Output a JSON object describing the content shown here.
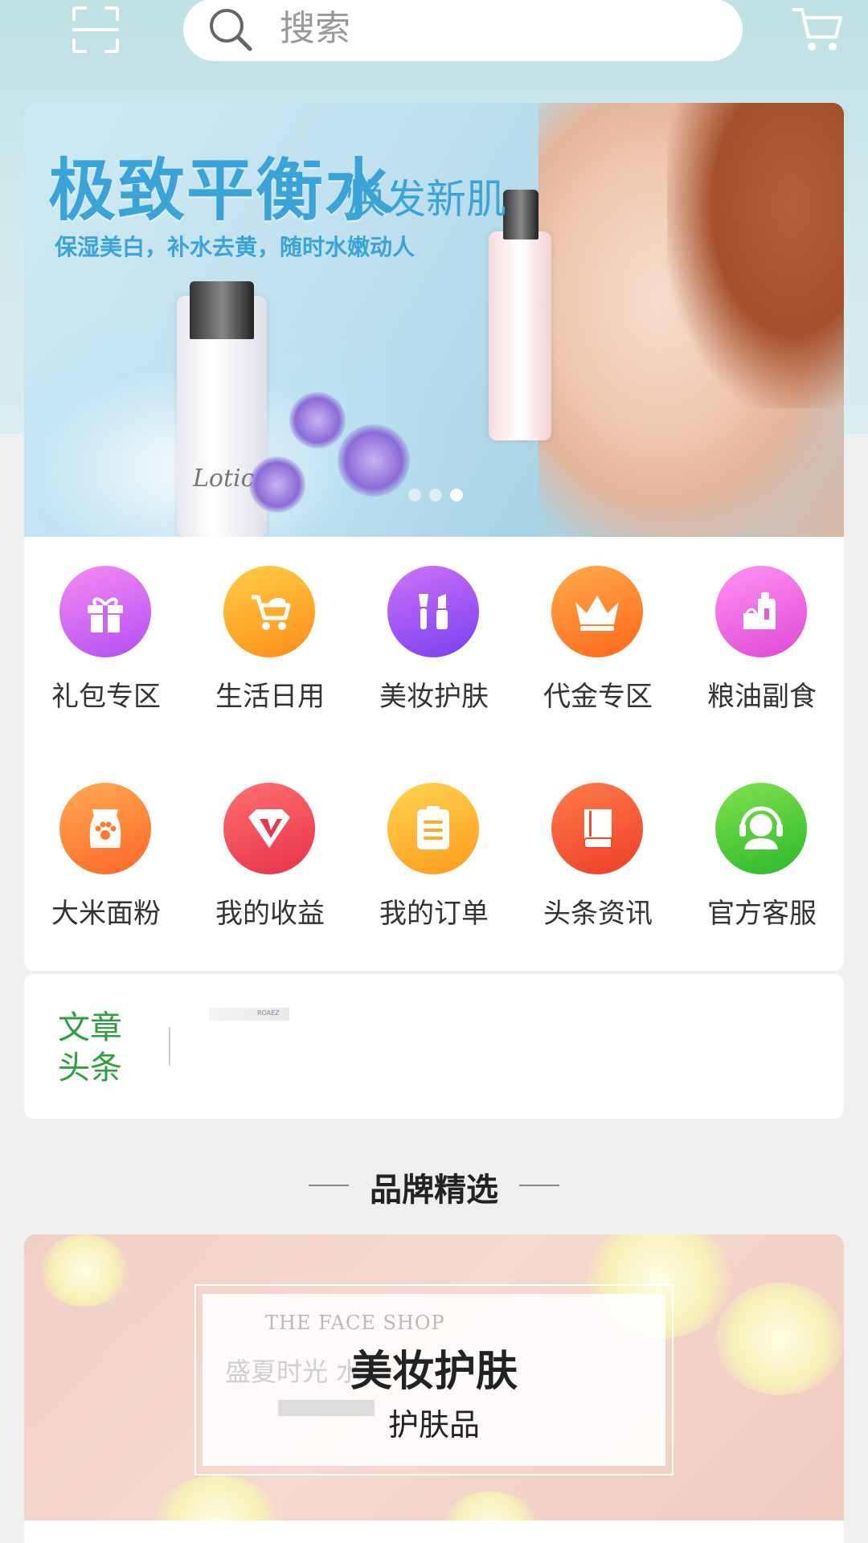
{
  "header": {
    "search_placeholder": "搜索",
    "scan_icon": "scan-icon",
    "cart_icon": "cart-icon"
  },
  "banner": {
    "title": "极致平衡水",
    "title_small": "焕发新肌",
    "subtitle": "保湿美白，补水去黄，随时水嫩动人",
    "bottle_text": "Lotic",
    "dots": 3,
    "active_dot": 2
  },
  "categories": {
    "items": [
      {
        "label": "礼包专区",
        "icon": "gift-icon",
        "color1": "#f07ff0",
        "color2": "#b44ef0"
      },
      {
        "label": "生活日用",
        "icon": "stroller-icon",
        "color1": "#ffc83d",
        "color2": "#ff8f1a"
      },
      {
        "label": "美妆护肤",
        "icon": "makeup-icon",
        "color1": "#c56cf8",
        "color2": "#7b3ff0"
      },
      {
        "label": "代金专区",
        "icon": "crown-icon",
        "color1": "#ffa347",
        "color2": "#ff6a1a"
      },
      {
        "label": "粮油副食",
        "icon": "oil-icon",
        "color1": "#ff8cf0",
        "color2": "#e04ed8"
      },
      {
        "label": "大米面粉",
        "icon": "rice-bag-icon",
        "color1": "#ffa350",
        "color2": "#ff6a28"
      },
      {
        "label": "我的收益",
        "icon": "diamond-icon",
        "color1": "#ff6b6b",
        "color2": "#e8344a"
      },
      {
        "label": "我的订单",
        "icon": "clipboard-icon",
        "color1": "#ffd450",
        "color2": "#ff9d1a"
      },
      {
        "label": "头条资讯",
        "icon": "book-icon",
        "color1": "#ff7a4a",
        "color2": "#f0402a"
      },
      {
        "label": "官方客服",
        "icon": "headset-icon",
        "color1": "#7ae04a",
        "color2": "#2ebd2a"
      }
    ]
  },
  "article": {
    "label_line1": "文章",
    "label_line2": "头条",
    "thumb_text": "ROAEZ"
  },
  "brand_section": {
    "title": "品牌精选",
    "card_title": "美妆护肤",
    "card_subtitle": "护肤品",
    "ghost_logo": "THE FACE SHOP",
    "ghost_text": "盛夏时光  水"
  },
  "colors": {
    "accent_green": "#2e9e3e",
    "background": "#efefef"
  }
}
